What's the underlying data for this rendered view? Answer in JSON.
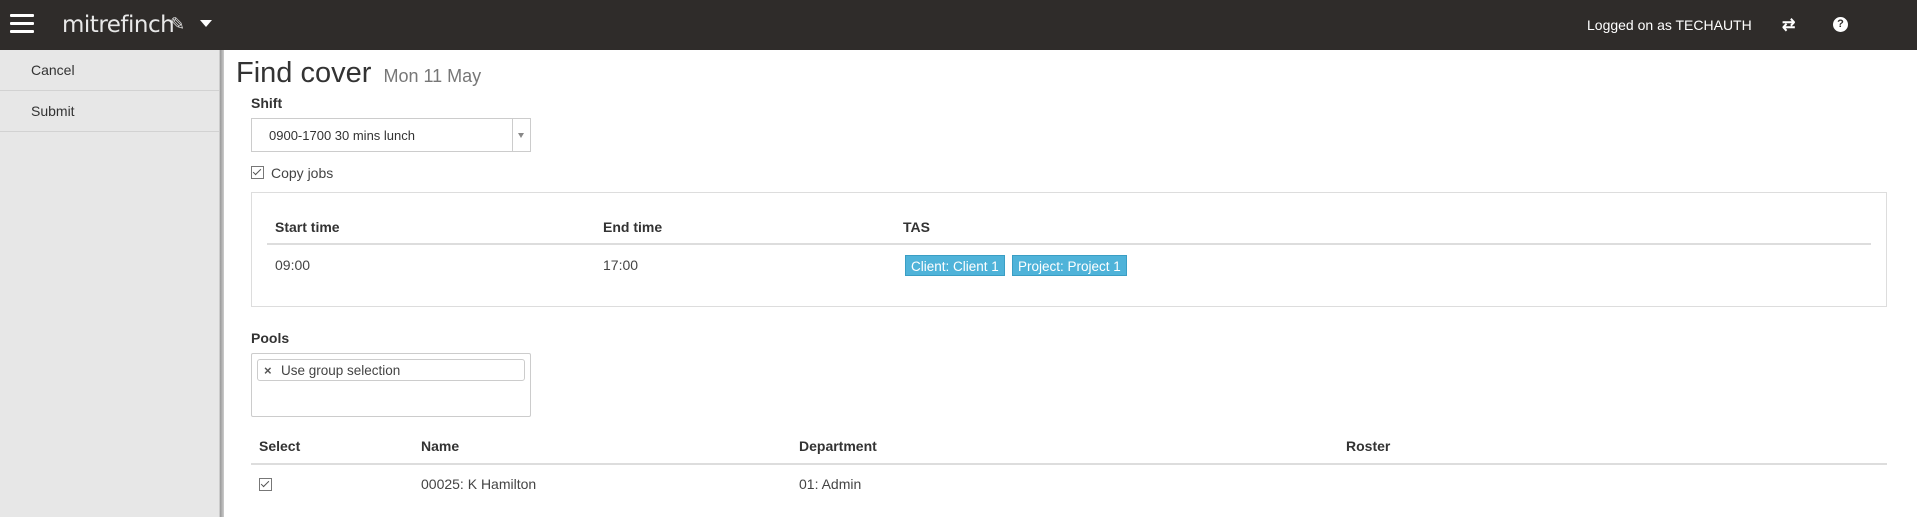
{
  "topbar": {
    "brand": "mitrefinch",
    "logged_on": "Logged on as TECHAUTH",
    "swap_glyph": "⇄",
    "help_glyph": "?"
  },
  "sidebar": {
    "items": [
      {
        "label": "Cancel"
      },
      {
        "label": "Submit"
      }
    ]
  },
  "page": {
    "title": "Find cover",
    "date": "Mon 11 May"
  },
  "shift": {
    "label": "Shift",
    "value": "0900-1700 30 mins lunch"
  },
  "copy_jobs": {
    "label": "Copy jobs",
    "checked": true
  },
  "jobs_table": {
    "headers": {
      "start": "Start time",
      "end": "End time",
      "tas": "TAS"
    },
    "rows": [
      {
        "start": "09:00",
        "end": "17:00",
        "tags": [
          "Client: Client 1",
          "Project: Project 1"
        ]
      }
    ]
  },
  "pools": {
    "label": "Pools",
    "chip": "Use group selection",
    "remove_glyph": "×"
  },
  "results_table": {
    "headers": {
      "select": "Select",
      "name": "Name",
      "department": "Department",
      "roster": "Roster"
    },
    "rows": [
      {
        "selected": true,
        "name": "00025: K Hamilton",
        "department": "01: Admin",
        "roster": ""
      }
    ]
  },
  "colors": {
    "topbar": "#2f2c2a",
    "sidebar": "#e7e7e7",
    "tag": "#4fb3d9"
  },
  "icons": [
    "menu-icon",
    "feather-icon",
    "caret-down-icon",
    "swap-icon",
    "help-icon",
    "checkbox-icon",
    "remove-icon",
    "dropdown-arrow-icon"
  ]
}
